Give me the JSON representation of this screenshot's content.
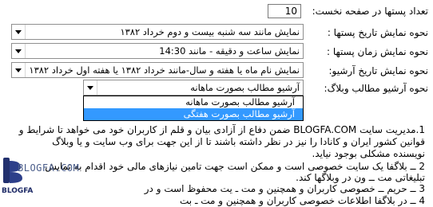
{
  "settings": {
    "posts_first_page": {
      "label": "تعداد پستها در صفحه نخست:",
      "value": "10"
    },
    "post_date_display": {
      "label": "نحوه نمایش تاریخ پستها :",
      "value": "نمایش مانند سه شنبه بیست و دوم خرداد ۱۳۸۲"
    },
    "post_time_display": {
      "label": "نحوه نمایش زمان پستها :",
      "value": "نمایش ساعت و دقیقه - مانند 14:30"
    },
    "archive_date_display": {
      "label": "نحوه نمایش تاریخ آرشیو:",
      "value": "نمایش نام ماه یا هفته و سال-مانند خرداد ۱۳۸۲ یا هفته اول خرداد ۱۳۸۲"
    },
    "archive_mode": {
      "label": "نحوه آرشیو مطالب وبلاگ:",
      "value": "آرشیو مطالب بصورت ماهانه",
      "options": [
        "آرشیو مطالب بصورت ماهانه",
        "آرشیو مطالب بصورت هفتگی"
      ],
      "highlighted_option_index": 1
    }
  },
  "terms_text": {
    "lines": [
      "1.مدیریت سایت BLOGFA.COM ضمن دفاع از آزادی بیان و قلم از کاربران خود می خواهد تا شرایط و",
      "قوانین کشور ایران و کانادا را نیز در نظر داشته باشند تا از این جهت برای وب سایت و یا وبلاگ",
      "نویسنده مشکلی بوجود نیاید.",
      "2 ــ بلاگفا یک سایت خصوصی است و ممکن است جهت تامین نیازهای مالی خود اقدام به نمایش",
      "تبلیغاتی مت ــ ون در وبلاگها کند.",
      "3 ــ حریم ــ خصوصی کاربران و همچنین و مت ـ یت محفوظ است و در",
      "4 ــ در بلاگفا اطلاعات خصوصی کاربران و همچنین و مت ـ بت"
    ]
  },
  "watermark": {
    "text": "BLOGFA.COM",
    "small_text": "BLOGFA"
  },
  "colors": {
    "selection": "#3399ff",
    "border": "#8f8f8f"
  },
  "icons": {
    "combo_button": "chevron-down-icon"
  }
}
